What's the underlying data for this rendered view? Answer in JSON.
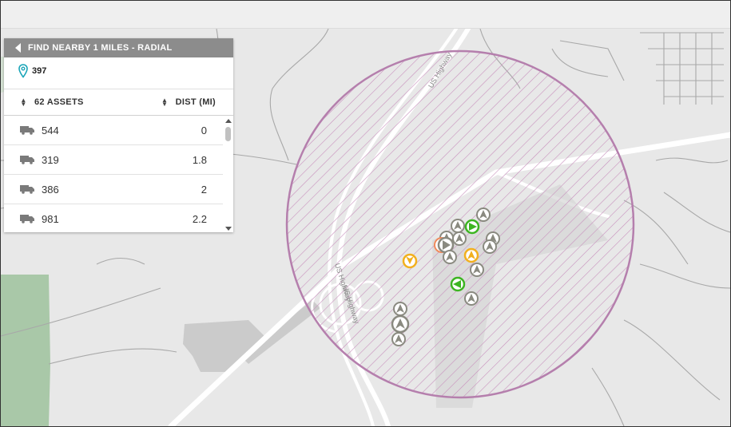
{
  "panel": {
    "title": "FIND NEARBY 1 MILES - RADIAL",
    "location": "397",
    "assets_header": "62 ASSETS",
    "dist_header": "DIST (MI)",
    "assets": [
      {
        "name": "544",
        "dist": "0"
      },
      {
        "name": "319",
        "dist": "1.8"
      },
      {
        "name": "386",
        "dist": "2"
      },
      {
        "name": "981",
        "dist": "2.2"
      }
    ]
  },
  "map": {
    "road_label_1": "US Highway",
    "road_label_2": "US Highway",
    "road_label_3": "US Highway",
    "colors": {
      "radius": "#b57fad",
      "accent_teal": "#1aa5b8",
      "marker_gray": "#8a8a80",
      "marker_green": "#3cb521",
      "marker_yellow": "#f2b01e",
      "marker_orange": "#f08a5c"
    }
  }
}
